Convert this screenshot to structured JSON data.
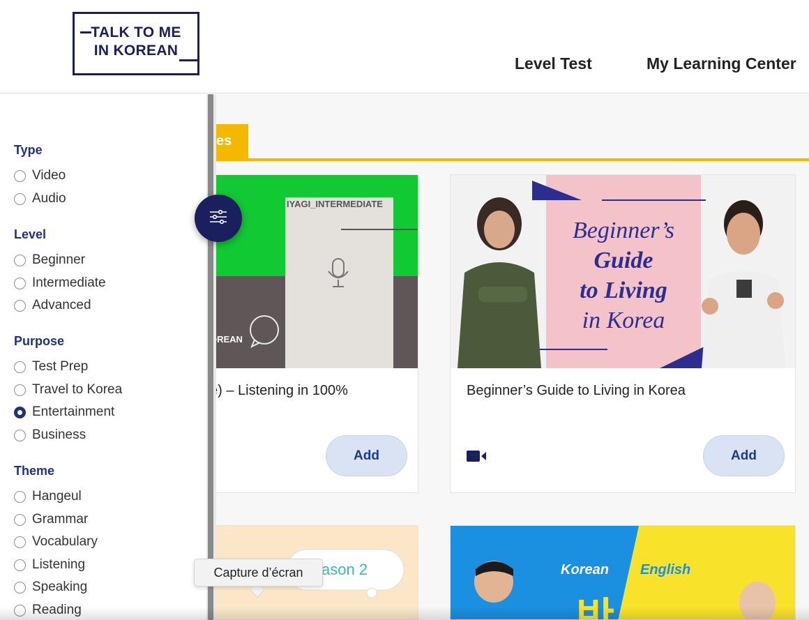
{
  "header": {
    "logo_line1": "TALK TO ME",
    "logo_line2": "IN KOREAN",
    "nav": [
      "Level Test",
      "My Learning Center"
    ]
  },
  "tab": {
    "label_partial": "es"
  },
  "sidebar": {
    "groups": [
      {
        "heading": "Type",
        "options": [
          {
            "label": "Video",
            "checked": false
          },
          {
            "label": "Audio",
            "checked": false
          }
        ]
      },
      {
        "heading": "Level",
        "options": [
          {
            "label": "Beginner",
            "checked": false
          },
          {
            "label": "Intermediate",
            "checked": false
          },
          {
            "label": "Advanced",
            "checked": false
          }
        ]
      },
      {
        "heading": "Purpose",
        "options": [
          {
            "label": "Test Prep",
            "checked": false
          },
          {
            "label": "Travel to Korea",
            "checked": false
          },
          {
            "label": "Entertainment",
            "checked": true
          },
          {
            "label": "Business",
            "checked": false
          }
        ]
      },
      {
        "heading": "Theme",
        "options": [
          {
            "label": "Hangeul",
            "checked": false
          },
          {
            "label": "Grammar",
            "checked": false
          },
          {
            "label": "Vocabulary",
            "checked": false
          },
          {
            "label": "Listening",
            "checked": false
          },
          {
            "label": "Speaking",
            "checked": false
          },
          {
            "label": "Reading",
            "checked": false
          }
        ]
      }
    ]
  },
  "cards": [
    {
      "title": "e) – Listening in 100%",
      "thumb_text": "IYAGI_INTERMEDIATE",
      "thumb_sub": "OREAN",
      "add_label": "Add"
    },
    {
      "title": "Beginner’s Guide to Living in Korea",
      "thumb_l1": "Beginner’s",
      "thumb_l2": "Guide",
      "thumb_l3": "to Living",
      "thumb_l4": "in Korea",
      "add_label": "Add",
      "media_icon": "video-camera-icon"
    },
    {
      "thumb_text": "ason 2"
    },
    {
      "thumb_korean": "Korean",
      "thumb_english": "English",
      "thumb_big": "반반"
    }
  ],
  "tooltip": {
    "text": "Capture d’écran"
  },
  "colors": {
    "navy": "#1b1f5b",
    "accent_yellow": "#f5b800",
    "heading_blue": "#23307a",
    "add_bg": "#d9e3f3"
  }
}
